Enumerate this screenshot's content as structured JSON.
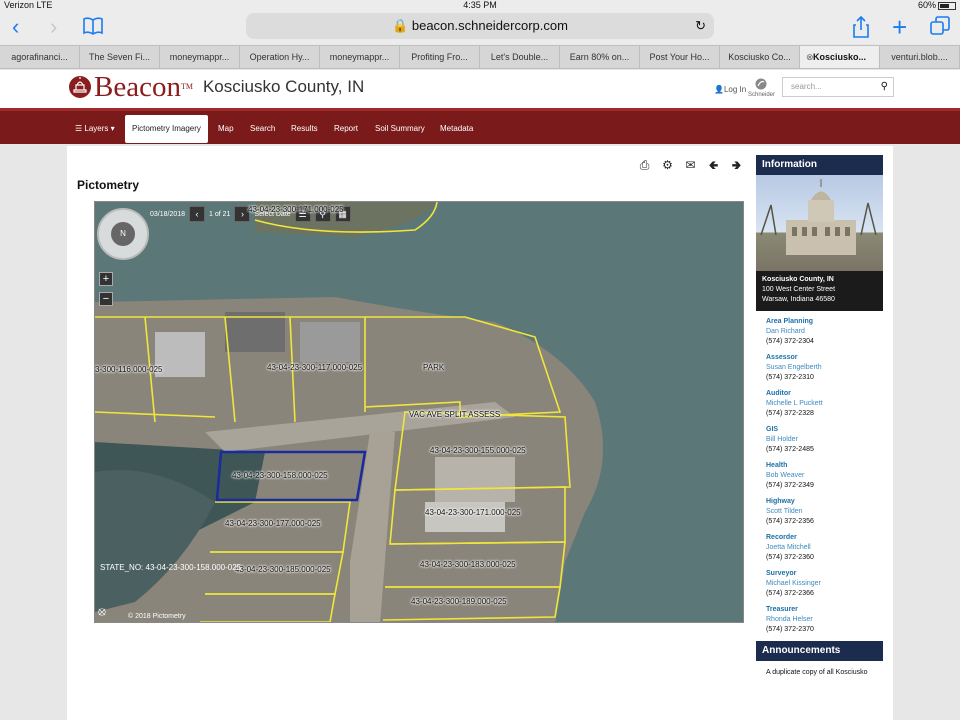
{
  "status": {
    "carrier": "Verizon",
    "network": "LTE",
    "time": "4:35 PM",
    "battery": "60%"
  },
  "browser": {
    "url": "beacon.schneidercorp.com"
  },
  "tabs": [
    {
      "label": "agorafinanci..."
    },
    {
      "label": "The Seven Fi..."
    },
    {
      "label": "moneymappr..."
    },
    {
      "label": "Operation Hy..."
    },
    {
      "label": "moneymappr..."
    },
    {
      "label": "Profiting Fro..."
    },
    {
      "label": "Let's Double..."
    },
    {
      "label": "Earn 80% on..."
    },
    {
      "label": "Post Your Ho..."
    },
    {
      "label": "Kosciusko Co..."
    },
    {
      "label": "Kosciusko...",
      "active": true
    },
    {
      "label": "venturi.blob...."
    }
  ],
  "header": {
    "logo": "Beacon",
    "tm": "TM",
    "county": "Kosciusko County, IN",
    "login": "Log In",
    "schneider": "Schneider",
    "search_placeholder": "search..."
  },
  "nav": {
    "layers": "Layers",
    "items": [
      "Pictometry Imagery",
      "Map",
      "Search",
      "Results",
      "Report",
      "Soil Summary",
      "Metadata"
    ]
  },
  "page": {
    "title": "Pictometry"
  },
  "map": {
    "date": "03/18/2018",
    "page": "1 of 21",
    "select_date": "Select Date",
    "copyright": "© 2018 Pictometry",
    "state_no": "STATE_NO: 43-04-23-300-158.000-025",
    "labels": {
      "p1": "43-04-23-300-171.000-025",
      "p2": "3-300-116.000-025",
      "p3": "43-04-23-300-117.000-025",
      "p4": "PARK",
      "p5": "VAC AVE SPLIT ASSESS",
      "p6": "43-04-23-300-155.000-025",
      "p7": "43-04-23-300-158.000-025",
      "p8": "43-04-23-300-177.000-025",
      "p9": "43-04-23-300-171.000-025",
      "p10": "43-04-23-300-185.000-025",
      "p11": "43-04-23-300-183.000-025",
      "p12": "43-04-23-300-189.000-025"
    }
  },
  "info": {
    "heading": "Information",
    "addr1": "Kosciusko County, IN",
    "addr2": "100 West Center Street",
    "addr3": "Warsaw, Indiana 46580",
    "contacts": [
      {
        "dept": "Area Planning",
        "name": "Dan Richard",
        "phone": "(574) 372-2304"
      },
      {
        "dept": "Assessor",
        "name": "Susan Engelberth",
        "phone": "(574) 372-2310"
      },
      {
        "dept": "Auditor",
        "name": "Michelle L Puckett",
        "phone": "(574) 372-2328"
      },
      {
        "dept": "GIS",
        "name": "Bill Holder",
        "phone": "(574) 372-2485"
      },
      {
        "dept": "Health",
        "name": "Bob Weaver",
        "phone": "(574) 372-2349"
      },
      {
        "dept": "Highway",
        "name": "Scott Tilden",
        "phone": "(574) 372-2356"
      },
      {
        "dept": "Recorder",
        "name": "Joetta Mitchell",
        "phone": "(574) 372-2360"
      },
      {
        "dept": "Surveyor",
        "name": "Michael Kissinger",
        "phone": "(574) 372-2366"
      },
      {
        "dept": "Treasurer",
        "name": "Rhonda Helser",
        "phone": "(574) 372-2370"
      }
    ],
    "announcements": "Announcements",
    "announcement_text": "A duplicate copy of all Kosciusko"
  }
}
